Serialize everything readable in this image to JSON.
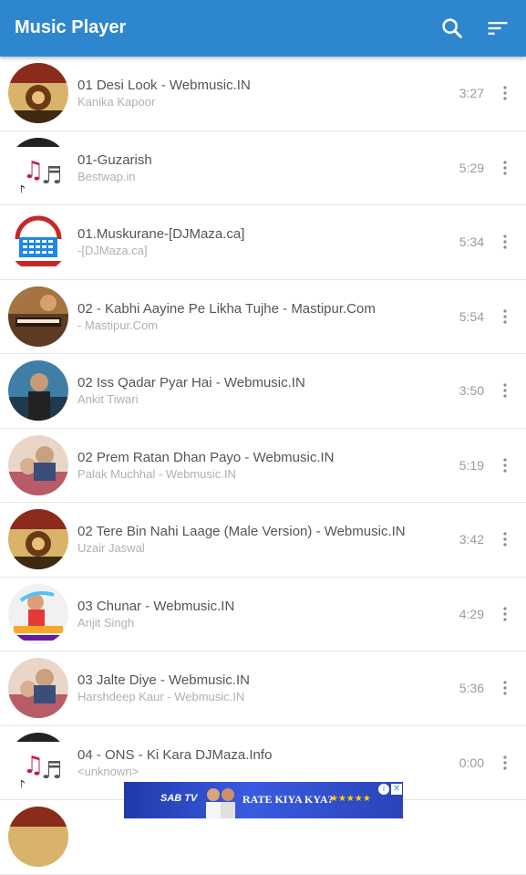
{
  "appbar": {
    "title": "Music Player",
    "accent": "#2e86cf",
    "icons": [
      "search-icon",
      "sort-icon"
    ]
  },
  "songs": [
    {
      "title": "01 Desi Look - Webmusic.IN",
      "artist": "Kanika Kapoor",
      "duration": "3:27",
      "art": "leela-art"
    },
    {
      "title": "01-Guzarish",
      "artist": "Bestwap.in",
      "duration": "5:29",
      "art": "music-notes-art"
    },
    {
      "title": "01.Muskurane-[DJMaza.ca]",
      "artist": "-[DJMaza.ca]",
      "duration": "5:34",
      "art": "djmaza-art"
    },
    {
      "title": "02 - Kabhi Aayine Pe Likha Tujhe - Mastipur.Com",
      "artist": "- Mastipur.Com",
      "duration": "5:54",
      "art": "piano-art"
    },
    {
      "title": "02 Iss Qadar Pyar Hai - Webmusic.IN",
      "artist": "Ankit Tiwari",
      "duration": "3:50",
      "art": "singer-art"
    },
    {
      "title": "02 Prem Ratan Dhan Payo - Webmusic.IN",
      "artist": "Palak Muchhal - Webmusic.IN",
      "duration": "5:19",
      "art": "couple-art"
    },
    {
      "title": "02 Tere Bin Nahi Laage (Male Version) - Webmusic.IN",
      "artist": "Uzair Jaswal",
      "duration": "3:42",
      "art": "leela-art"
    },
    {
      "title": "03 Chunar - Webmusic.IN",
      "artist": "Arijit Singh",
      "duration": "4:29",
      "art": "dancer-art"
    },
    {
      "title": "03 Jalte Diye - Webmusic.IN",
      "artist": "Harshdeep Kaur - Webmusic.IN",
      "duration": "5:36",
      "art": "couple-art"
    },
    {
      "title": "04 - ONS - Ki Kara  DJMaza.Info",
      "artist": "<unknown>",
      "duration": "0:00",
      "art": "music-notes-art"
    }
  ],
  "ad": {
    "brand": "SAB TV",
    "text": "RATE KIYA KYA?",
    "stars": "★★★★★"
  }
}
